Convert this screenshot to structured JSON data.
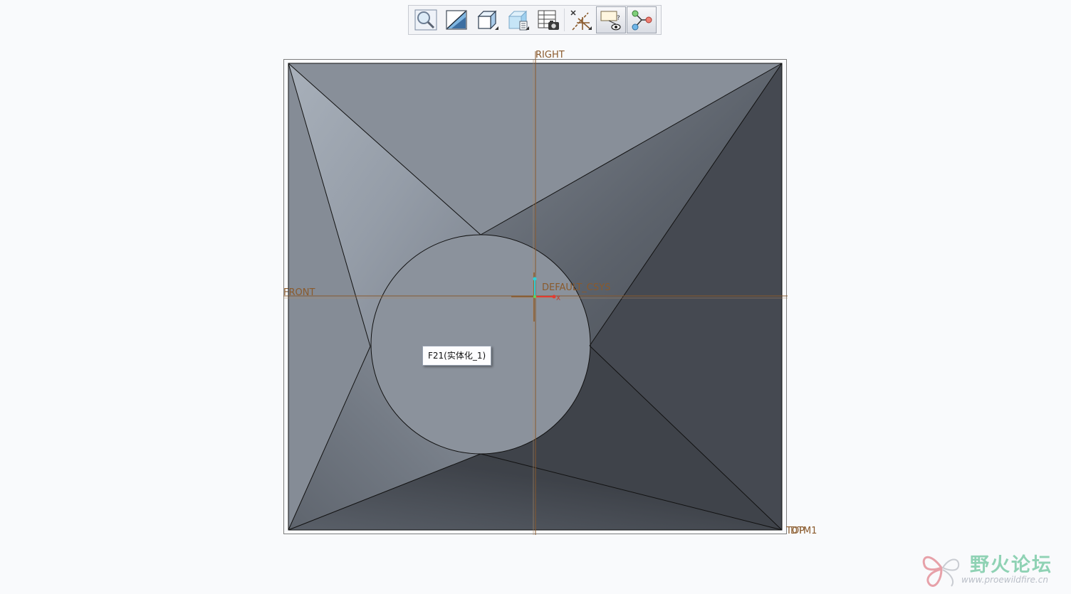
{
  "toolbar": {
    "buttons": [
      {
        "name": "zoom-tool",
        "icon": "magnifier-icon",
        "active": false
      },
      {
        "name": "repaint-tool",
        "icon": "repaint-icon",
        "active": false
      },
      {
        "name": "display-style-tool",
        "icon": "cube-icon",
        "active": false
      },
      {
        "name": "saved-orientations-tool",
        "icon": "saved-views-icon",
        "active": false
      },
      {
        "name": "view-manager-tool",
        "icon": "view-manager-icon",
        "active": false
      },
      {
        "name": "datum-display-tool",
        "icon": "datum-display-icon",
        "active": false
      },
      {
        "name": "annotation-display-tool",
        "icon": "annotation-eye-icon",
        "active": true
      },
      {
        "name": "spin-center-tool",
        "icon": "spin-center-icon",
        "active": true
      }
    ]
  },
  "model": {
    "datum_labels": {
      "right": "RIGHT",
      "front": "FRONT",
      "csys": "DEFAULT_CSYS",
      "top": "TOP",
      "dtm": "DTM1"
    },
    "axis_x_label": "X",
    "tooltip": "F21(实体化_1)",
    "colors": {
      "background": "#f9fafc",
      "face_light": "#8e959f",
      "face_dark": "#43474e",
      "datum": "#8a5a2c",
      "edge": "#111111"
    }
  },
  "watermark": {
    "title": "野火论坛",
    "url": "www.proewildfire.cn"
  }
}
